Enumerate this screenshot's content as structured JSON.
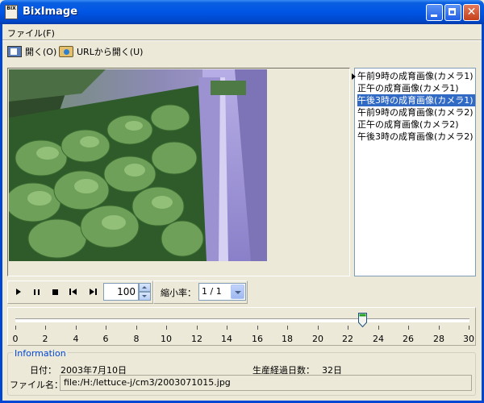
{
  "window": {
    "title": "BixImage",
    "icon_text": "BIX"
  },
  "menu": {
    "file_label": "ファイル(F)"
  },
  "toolbar": {
    "open_label": "開く(O)",
    "open_url_label": "URLから開く(U)"
  },
  "image_list": {
    "items": [
      "午前9時の成育画像(カメラ1)",
      "正午の成育画像(カメラ1)",
      "午後3時の成育画像(カメラ1)",
      "午前9時の成育画像(カメラ2)",
      "正午の成育画像(カメラ2)",
      "午後3時の成育画像(カメラ2)"
    ],
    "selected_index": 2
  },
  "playback": {
    "speed_value": "100"
  },
  "zoom": {
    "label": "縮小率：",
    "value": "1 / 1"
  },
  "slider": {
    "value": 23,
    "min": 0,
    "max": 30,
    "tick_labels": [
      "0",
      "2",
      "4",
      "6",
      "8",
      "10",
      "12",
      "14",
      "16",
      "18",
      "20",
      "22",
      "24",
      "26",
      "28",
      "30"
    ]
  },
  "info": {
    "legend": "Information",
    "date_label": "日付：",
    "date_value": "2003年7月10日",
    "days_label": "生産経過日数：",
    "days_value": "32日",
    "file_label": "ファイル名：",
    "file_value": "file:/H:/lettuce-j/cm3/2003071015.jpg"
  },
  "colors": {
    "title_bar": "#0055E5",
    "selection": "#316AC5",
    "info_legend": "#0046D5"
  }
}
